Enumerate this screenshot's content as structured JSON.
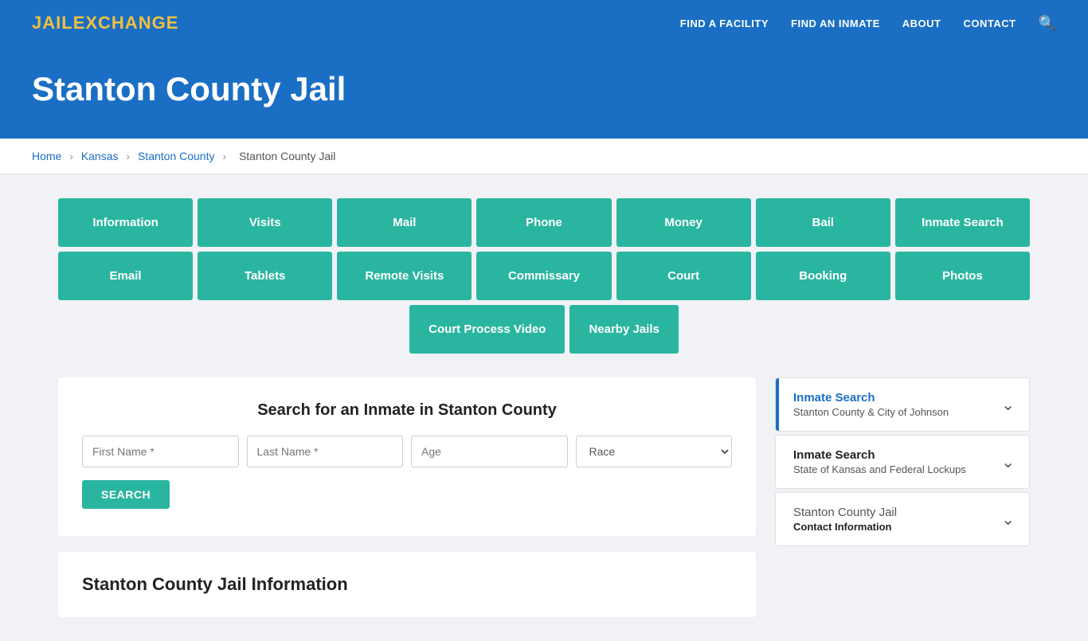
{
  "nav": {
    "logo_jail": "JAIL",
    "logo_exchange": "EXCHANGE",
    "links": [
      {
        "label": "FIND A FACILITY",
        "name": "find-facility"
      },
      {
        "label": "FIND AN INMATE",
        "name": "find-inmate"
      },
      {
        "label": "ABOUT",
        "name": "about"
      },
      {
        "label": "CONTACT",
        "name": "contact"
      }
    ]
  },
  "hero": {
    "title": "Stanton County Jail"
  },
  "breadcrumb": {
    "items": [
      {
        "label": "Home",
        "name": "home"
      },
      {
        "label": "Kansas",
        "name": "kansas"
      },
      {
        "label": "Stanton County",
        "name": "stanton-county"
      },
      {
        "label": "Stanton County Jail",
        "name": "stanton-county-jail"
      }
    ]
  },
  "button_grid_row1": [
    {
      "label": "Information",
      "name": "btn-information"
    },
    {
      "label": "Visits",
      "name": "btn-visits"
    },
    {
      "label": "Mail",
      "name": "btn-mail"
    },
    {
      "label": "Phone",
      "name": "btn-phone"
    },
    {
      "label": "Money",
      "name": "btn-money"
    },
    {
      "label": "Bail",
      "name": "btn-bail"
    },
    {
      "label": "Inmate Search",
      "name": "btn-inmate-search"
    }
  ],
  "button_grid_row2": [
    {
      "label": "Email",
      "name": "btn-email"
    },
    {
      "label": "Tablets",
      "name": "btn-tablets"
    },
    {
      "label": "Remote Visits",
      "name": "btn-remote-visits"
    },
    {
      "label": "Commissary",
      "name": "btn-commissary"
    },
    {
      "label": "Court",
      "name": "btn-court"
    },
    {
      "label": "Booking",
      "name": "btn-booking"
    },
    {
      "label": "Photos",
      "name": "btn-photos"
    }
  ],
  "button_grid_row3": [
    {
      "label": "Court Process Video",
      "name": "btn-court-process-video"
    },
    {
      "label": "Nearby Jails",
      "name": "btn-nearby-jails"
    }
  ],
  "search": {
    "title": "Search for an Inmate in Stanton County",
    "first_name_placeholder": "First Name *",
    "last_name_placeholder": "Last Name *",
    "age_placeholder": "Age",
    "race_placeholder": "Race",
    "button_label": "SEARCH"
  },
  "info_section": {
    "title": "Stanton County Jail Information"
  },
  "sidebar": {
    "cards": [
      {
        "name": "sidebar-inmate-search-stanton",
        "title": "Inmate Search",
        "subtitle": "Stanton County & City of Johnson",
        "active": true
      },
      {
        "name": "sidebar-inmate-search-kansas",
        "title": "Inmate Search",
        "subtitle": "State of Kansas and Federal Lockups",
        "active": false
      },
      {
        "name": "sidebar-contact-info",
        "title": "Stanton County Jail",
        "subtitle": "Contact Information",
        "active": false
      }
    ]
  }
}
